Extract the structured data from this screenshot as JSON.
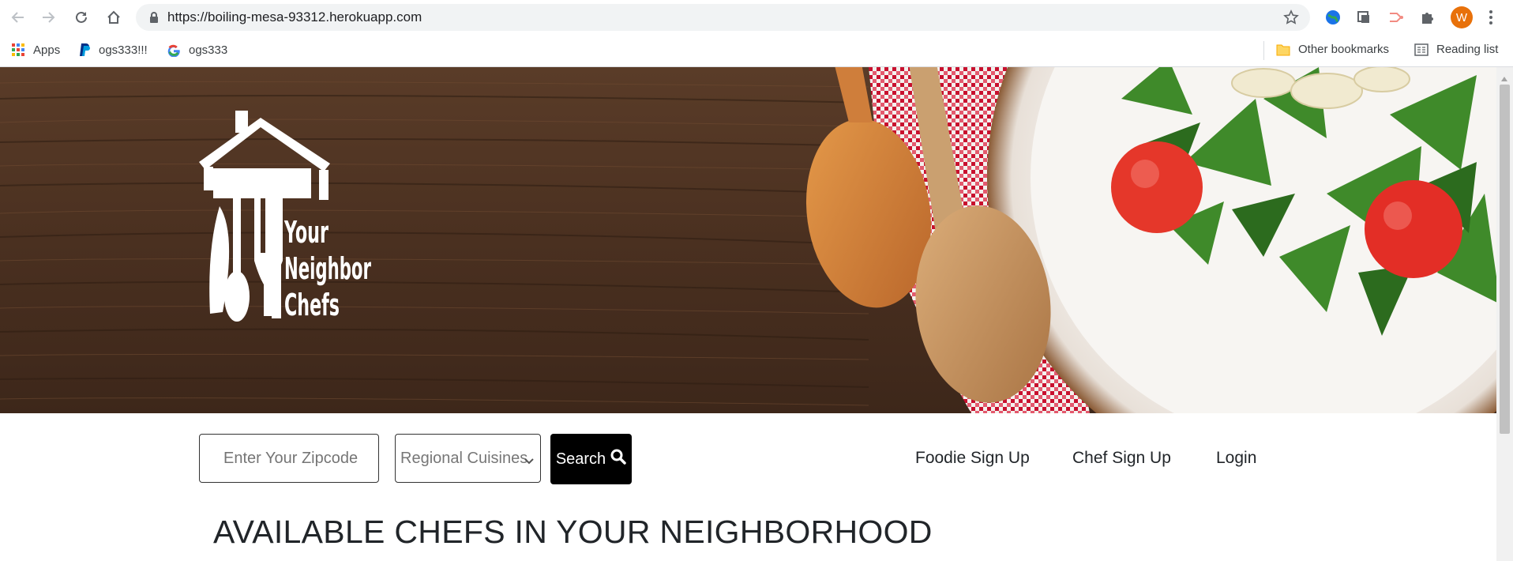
{
  "browser": {
    "url": "https://boiling-mesa-93312.herokuapp.com",
    "avatar_letter": "W",
    "bookmarks": {
      "apps": "Apps",
      "paypal": "ogs333!!!",
      "google": "ogs333",
      "other": "Other bookmarks",
      "reading_list": "Reading list"
    }
  },
  "hero": {
    "logo_lines": [
      "Your",
      "Neighbor",
      "Chefs"
    ]
  },
  "search": {
    "zip_placeholder": "Enter Your Zipcode",
    "cuisine_selected": "Regional Cuisines",
    "search_label": "Search"
  },
  "nav": {
    "foodie": "Foodie Sign Up",
    "chef": "Chef Sign Up",
    "login": "Login"
  },
  "main": {
    "heading": "AVAILABLE CHEFS IN YOUR NEIGHBORHOOD"
  },
  "colors": {
    "wood": "#4a3222",
    "button": "#000000",
    "avatar": "#e8710a"
  }
}
